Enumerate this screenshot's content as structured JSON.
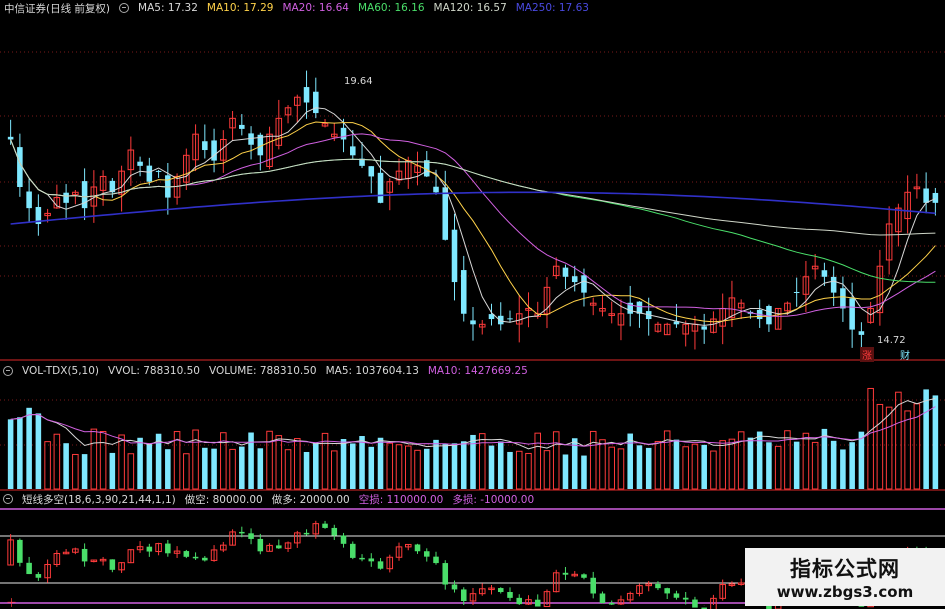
{
  "colors": {
    "up": "#ff3b3b",
    "down": "#7fe8ff",
    "white": "#d8d8d8",
    "yellow": "#ffd24a",
    "purple": "#d060e0",
    "green": "#4ade6a",
    "blue": "#3030c8",
    "grid": "#7a1a1a",
    "ma120": "#cfd6c8"
  },
  "main_header": {
    "title": "中信证券(日线 前复权)",
    "ma5": "MA5: 17.32",
    "ma10": "MA10: 17.29",
    "ma20": "MA20: 16.64",
    "ma60": "MA60: 16.16",
    "ma120": "MA120: 16.57",
    "ma250": "MA250: 17.63"
  },
  "vol_header": {
    "name": "VOL-TDX(5,10)",
    "vvol": "VVOL: 788310.50",
    "volume": "VOLUME: 788310.50",
    "ma5": "MA5: 1037604.13",
    "ma10": "MA10: 1427669.25"
  },
  "ind_header": {
    "name": "短线多空(18,6,3,90,21,44,1,1)",
    "zuokong": "做空: 80000.00",
    "zuoduo": "做多: 20000.00",
    "kongsun": "空损: 110000.00",
    "duosun": "多损: -10000.00"
  },
  "markers": {
    "high": "19.64",
    "low": "14.72",
    "bottom_left": "十",
    "tags": [
      "涨",
      "财"
    ]
  },
  "watermark": {
    "line1": "指标公式网",
    "line2": "www.zbgs3.com"
  },
  "chart_data": [
    {
      "type": "candlestick",
      "title": "中信证券(日线 前复权)",
      "price_range": [
        14.4,
        20.8
      ],
      "marked_high": 19.64,
      "marked_low": 14.72,
      "close": [
        18.5,
        17.6,
        17.2,
        16.9,
        17.1,
        17.4,
        17.3,
        17.5,
        17.2,
        17.6,
        17.8,
        17.5,
        17.9,
        18.3,
        18.0,
        17.7,
        17.9,
        17.4,
        17.8,
        18.2,
        18.6,
        18.3,
        18.1,
        18.5,
        18.9,
        18.7,
        18.4,
        18.2,
        18.6,
        18.9,
        19.1,
        19.3,
        19.2,
        19.0,
        18.8,
        18.6,
        18.5,
        18.2,
        18.0,
        17.8,
        17.3,
        17.7,
        17.9,
        18.1,
        18.0,
        17.8,
        17.5,
        16.6,
        15.8,
        15.2,
        15.0,
        15.0,
        15.1,
        15.0,
        15.1,
        15.2,
        15.3,
        15.2,
        15.7,
        16.1,
        15.9,
        15.8,
        15.6,
        15.4,
        15.3,
        15.2,
        15.2,
        15.2,
        15.2,
        15.1,
        15.0,
        15.0,
        15.0,
        15.0,
        15.0,
        14.9,
        15.1,
        15.3,
        15.5,
        15.4,
        15.2,
        15.1,
        15.0,
        15.3,
        15.4,
        15.6,
        15.9,
        16.1,
        15.9,
        15.6,
        15.3,
        14.9,
        14.8,
        15.3,
        16.1,
        16.9,
        17.2,
        17.5,
        17.6,
        17.3,
        17.3
      ],
      "series": [
        {
          "name": "MA5",
          "value": 17.32
        },
        {
          "name": "MA10",
          "value": 17.29
        },
        {
          "name": "MA20",
          "value": 16.64
        },
        {
          "name": "MA60",
          "value": 16.16
        },
        {
          "name": "MA120",
          "value": 16.57
        },
        {
          "name": "MA250",
          "value": 17.63
        }
      ]
    },
    {
      "type": "bar",
      "title": "VOL-TDX(5,10)",
      "ylim": [
        0,
        3600000
      ],
      "last_volume": 788310.5,
      "series": [
        {
          "name": "MA5",
          "value": 1037604.13
        },
        {
          "name": "MA10",
          "value": 1427669.25
        }
      ]
    },
    {
      "type": "candlestick",
      "title": "短线多空(18,6,3,90,21,44,1,1)",
      "levels": [
        {
          "name": "做空",
          "value": 80000.0
        },
        {
          "name": "做多",
          "value": 20000.0
        },
        {
          "name": "空损",
          "value": 110000.0
        },
        {
          "name": "多损",
          "value": -10000.0
        }
      ]
    }
  ]
}
